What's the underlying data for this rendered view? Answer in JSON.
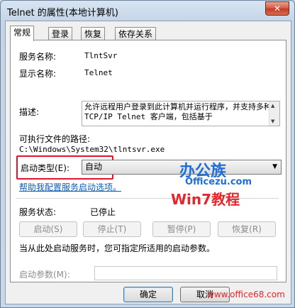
{
  "window": {
    "title": "Telnet 的属性(本地计算机)",
    "close_symbol": "✕"
  },
  "tabs": [
    {
      "label": "常规"
    },
    {
      "label": "登录"
    },
    {
      "label": "恢复"
    },
    {
      "label": "依存关系"
    }
  ],
  "general": {
    "service_name_label": "服务名称:",
    "service_name_value": "TlntSvr",
    "display_name_label": "显示名称:",
    "display_name_value": "Telnet",
    "description_label": "描述:",
    "description_text": "允许远程用户登录到此计算机并运行程序，并支持多种 TCP/IP Telnet 客户端，包括基于",
    "exe_path_label": "可执行文件的路径:",
    "exe_path_value": "C:\\Windows\\System32\\tlntsvr.exe",
    "startup_type_label": "启动类型(E):",
    "startup_type_value": "自动",
    "help_link": "帮助我配置服务启动选项。",
    "service_status_label": "服务状态:",
    "service_status_value": "已停止",
    "start_button": "启动(S)",
    "stop_button": "停止(T)",
    "pause_button": "暂停(P)",
    "resume_button": "恢复(R)",
    "start_params_hint": "当从此处启动服务时，您可指定所适用的启动参数。",
    "start_params_label": "启动参数(M):",
    "start_params_value": ""
  },
  "footer": {
    "ok_button": "确定",
    "cancel_button": "取消"
  },
  "watermark": {
    "brand_cn": "办公族",
    "domain": "Officezu.com",
    "win7_text": "Win7教程",
    "site_url": "www.office68.com"
  },
  "colors": {
    "link": "#0b5db9",
    "highlight": "#e0142d",
    "brand_blue": "#1f6fd6",
    "brand_red": "#e5262b"
  }
}
